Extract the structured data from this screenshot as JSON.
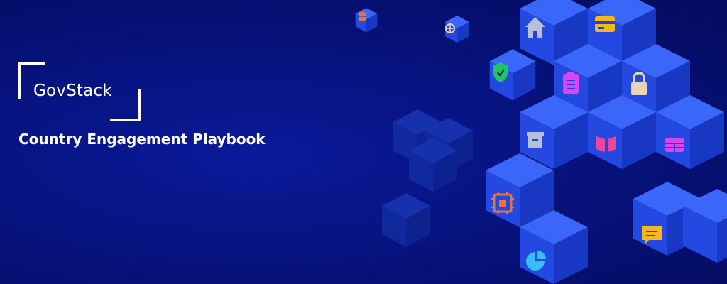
{
  "logo": {
    "name": "GovStack"
  },
  "banner": {
    "subtitle": "Country Engagement Playbook"
  },
  "icons": [
    "database-icon",
    "globe-icon",
    "home-icon",
    "credit-card-icon",
    "shield-check-icon",
    "clipboard-list-icon",
    "lock-icon",
    "archive-box-icon",
    "open-book-icon",
    "table-icon",
    "cpu-chip-icon",
    "chat-bubble-icon",
    "pie-chart-icon"
  ],
  "colors": {
    "background": "#07137f",
    "cube_top": "#2f5bf5",
    "cube_left": "#1f43dc",
    "cube_right": "#1533bb",
    "accent_orange": "#e8743a",
    "accent_green": "#22c55e",
    "accent_yellow": "#f4b81c",
    "accent_magenta": "#d946ef",
    "accent_pink": "#ec4899",
    "accent_sky": "#38bdf8",
    "accent_beige": "#e8d5b5",
    "accent_gray": "#b8bfd6"
  }
}
